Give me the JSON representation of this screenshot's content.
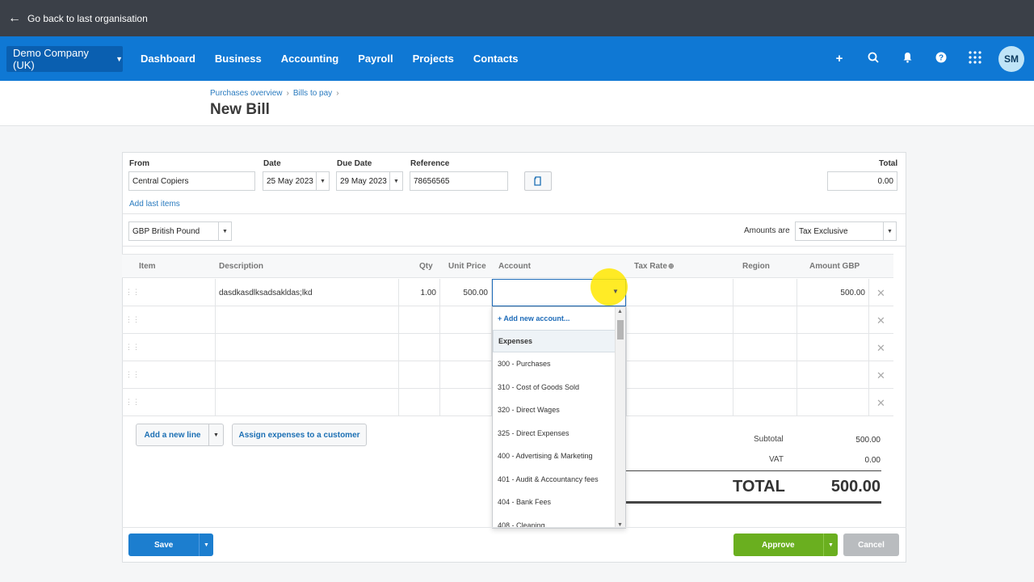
{
  "topbar": {
    "back_label": "Go back to last organisation"
  },
  "nav": {
    "org": "Demo Company (UK)",
    "items": [
      "Dashboard",
      "Business",
      "Accounting",
      "Payroll",
      "Projects",
      "Contacts"
    ],
    "avatar": "SM"
  },
  "breadcrumb": [
    "Purchases overview",
    "Bills to pay"
  ],
  "title": "New Bill",
  "form": {
    "from_label": "From",
    "from_value": "Central Copiers",
    "date_label": "Date",
    "date_value": "25 May 2023",
    "due_label": "Due Date",
    "due_value": "29 May 2023",
    "ref_label": "Reference",
    "ref_value": "78656565",
    "total_label": "Total",
    "total_value": "0.00",
    "add_last_items": "Add last items",
    "currency": "GBP British Pound",
    "amounts_are_label": "Amounts are",
    "amounts_are_value": "Tax Exclusive"
  },
  "table": {
    "headers": [
      "Item",
      "Description",
      "Qty",
      "Unit Price",
      "Account",
      "Tax Rate",
      "Region",
      "Amount GBP"
    ],
    "rows": [
      {
        "item": "",
        "description": "dasdkasdlksadsakldas;lkd",
        "qty": "1.00",
        "unit_price": "500.00",
        "account": "",
        "tax_rate": "",
        "region": "",
        "amount": "500.00"
      }
    ]
  },
  "account_dropdown": {
    "add_new": "+ Add new account...",
    "group": "Expenses",
    "items": [
      "300 - Purchases",
      "310 - Cost of Goods Sold",
      "320 - Direct Wages",
      "325 - Direct Expenses",
      "400 - Advertising & Marketing",
      "401 - Audit & Accountancy fees",
      "404 - Bank Fees",
      "408 - Cleaning"
    ]
  },
  "buttons": {
    "add_line": "Add a new line",
    "assign": "Assign expenses to a customer",
    "save": "Save",
    "approve": "Approve",
    "cancel": "Cancel"
  },
  "totals": {
    "subtotal_label": "Subtotal",
    "subtotal": "500.00",
    "vat_label": "VAT",
    "vat": "0.00",
    "total_label": "TOTAL",
    "total": "500.00"
  }
}
